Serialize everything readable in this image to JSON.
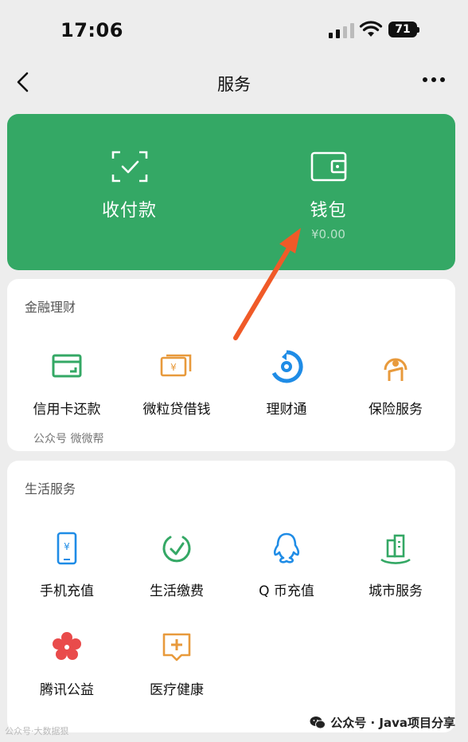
{
  "status_bar": {
    "time": "17:06",
    "battery": "71"
  },
  "nav": {
    "title": "服务"
  },
  "wallet_card": {
    "pay_label": "收付款",
    "wallet_label": "钱包",
    "wallet_amount": "¥0.00",
    "color": "#34a865"
  },
  "finance": {
    "title": "金融理财",
    "items": [
      {
        "label": "信用卡还款",
        "icon": "credit-card-icon"
      },
      {
        "label": "微粒贷借钱",
        "icon": "loan-icon"
      },
      {
        "label": "理财通",
        "icon": "wealth-icon"
      },
      {
        "label": "保险服务",
        "icon": "insurance-icon"
      }
    ],
    "note": "公众号  微微帮"
  },
  "life": {
    "title": "生活服务",
    "items": [
      {
        "label": "手机充值",
        "icon": "phone-topup-icon"
      },
      {
        "label": "生活缴费",
        "icon": "utility-bill-icon"
      },
      {
        "label": "Q 币充值",
        "icon": "qq-coin-icon"
      },
      {
        "label": "城市服务",
        "icon": "city-service-icon"
      },
      {
        "label": "腾讯公益",
        "icon": "charity-icon"
      },
      {
        "label": "医疗健康",
        "icon": "medical-icon"
      }
    ]
  },
  "watermark": {
    "left": "公众号·大数据狠",
    "right": "公众号 · Java项目分享"
  },
  "colors": {
    "arrow": "#f05a28",
    "blue": "#1f8ce6",
    "green": "#34a865",
    "orange": "#e89a3c",
    "red": "#e94b4b"
  }
}
